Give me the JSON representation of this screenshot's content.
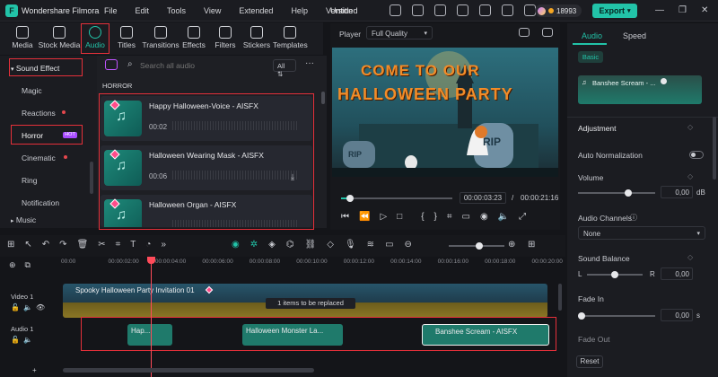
{
  "app": {
    "title": "Wondershare Filmora",
    "doc_title": "Untitled",
    "credits": "18993",
    "export_label": "Export"
  },
  "menu": [
    "File",
    "Edit",
    "Tools",
    "View",
    "Extended",
    "Help",
    "Version"
  ],
  "tabs": [
    {
      "label": "Media",
      "icon": "media-icon"
    },
    {
      "label": "Stock Media",
      "icon": "stock-media-icon"
    },
    {
      "label": "Audio",
      "icon": "music-note-icon"
    },
    {
      "label": "Titles",
      "icon": "titles-icon"
    },
    {
      "label": "Transitions",
      "icon": "transitions-icon"
    },
    {
      "label": "Effects",
      "icon": "effects-icon"
    },
    {
      "label": "Filters",
      "icon": "filters-icon"
    },
    {
      "label": "Stickers",
      "icon": "stickers-icon"
    },
    {
      "label": "Templates",
      "icon": "templates-icon"
    }
  ],
  "sidebar": {
    "section": "Sound Effect",
    "items": [
      "Magic",
      "Reactions",
      "Horror",
      "Cinematic",
      "Ring",
      "Notification"
    ],
    "hot_badge": "HOT",
    "music": "Music"
  },
  "audio": {
    "search_placeholder": "Search all audio",
    "filter": "All",
    "category": "HORROR",
    "items": [
      {
        "name": "Happy Halloween-Voice - AISFX",
        "duration": "00:02"
      },
      {
        "name": "Halloween Wearing Mask - AISFX",
        "duration": "00:06"
      },
      {
        "name": "Halloween Organ - AISFX",
        "duration": ""
      }
    ]
  },
  "player": {
    "label": "Player",
    "quality": "Full Quality",
    "current": "00:00:03:23",
    "separator": "/",
    "total": "00:00:21:16",
    "progress": 0.08,
    "video_line1": "COME TO OUR",
    "video_line2": "HALLOWEEN PARTY",
    "tomb1": "RIP",
    "tomb2": "RIP"
  },
  "right": {
    "tabs": [
      "Audio",
      "Speed"
    ],
    "basic": "Basic",
    "clip_name": "Banshee Scream - ...",
    "adjustment": "Adjustment",
    "auto_norm": "Auto Normalization",
    "volume_label": "Volume",
    "volume_value": "0,00",
    "volume_unit": "dB",
    "volume_level": 0.65,
    "channels_label": "Audio Channels",
    "channels_value": "None",
    "balance_label": "Sound Balance",
    "balance_l": "L",
    "balance_r": "R",
    "balance_value": "0,00",
    "balance_level": 0.5,
    "fadein_label": "Fade In",
    "fadein_value": "0,00",
    "fadein_unit": "s",
    "fadeout_label": "Fade Out",
    "reset": "Reset"
  },
  "timeline": {
    "ruler": [
      "00:00",
      "00:00:02:00",
      "00:00:04:00",
      "00:00:06:00",
      "00:00:08:00",
      "00:00:10:00",
      "00:00:12:00",
      "00:00:14:00",
      "00:00:16:00",
      "00:00:18:00",
      "00:00:20:00"
    ],
    "video_track": "Video 1",
    "audio_track": "Audio 1",
    "video_clip": "Spooky Halloween Party Invitation 01",
    "replace_msg": "1 items to be replaced",
    "audio_clips": [
      "Hap...",
      "Halloween Monster La...",
      "Banshee Scream - AISFX"
    ]
  },
  "colors": {
    "accent": "#22c3a8",
    "highlight": "#e5303a",
    "audio_clip": "#1f7a6b",
    "playhead": "#ff4b5a"
  }
}
